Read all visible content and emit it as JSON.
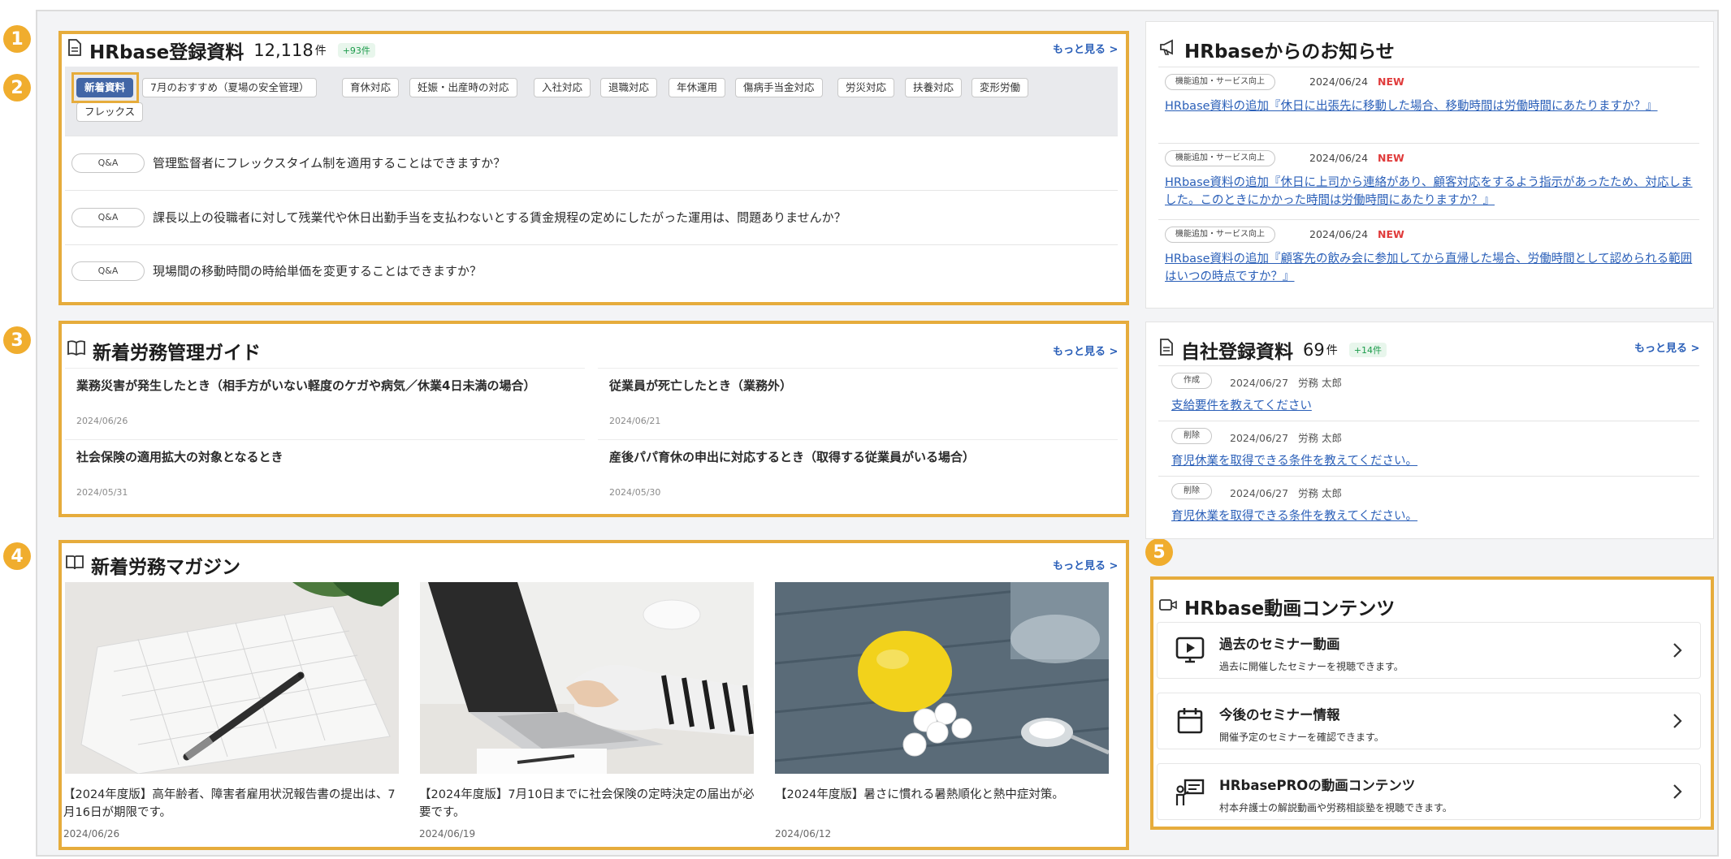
{
  "markers": [
    "1",
    "2",
    "3",
    "4",
    "5"
  ],
  "accent_color": "#e6ac3c",
  "link_color": "#2a5fb8",
  "common": {
    "more_label": "もっと見る >"
  },
  "docs": {
    "title": "HRbase登録資料",
    "count": "12,118",
    "unit": "件",
    "delta": "+93件",
    "icon": "document-icon",
    "filters": [
      "新着資料",
      "7月のおすすめ（夏場の安全管理）",
      "育休対応",
      "妊娠・出産時の対応",
      "入社対応",
      "退職対応",
      "年休運用",
      "傷病手当金対応",
      "労災対応",
      "扶養対応",
      "変形労働",
      "フレックス"
    ],
    "active_filter": "新着資料",
    "items": [
      {
        "badge": "Q&A",
        "text": "管理監督者にフレックスタイム制を適用することはできますか？"
      },
      {
        "badge": "Q&A",
        "text": "課長以上の役職者に対して残業代や休日出勤手当を支払わないとする賃金規程の定めにしたがった運用は、問題ありませんか？"
      },
      {
        "badge": "Q&A",
        "text": "現場間の移動時間の時給単価を変更することはできますか？"
      }
    ]
  },
  "guide": {
    "title": "新着労務管理ガイド",
    "icon": "book-icon",
    "items": [
      {
        "title": "業務災害が発生したとき（相手方がいない軽度のケガや病気／休業4日未満の場合）",
        "date": "2024/06/26"
      },
      {
        "title": "従業員が死亡したとき（業務外）",
        "date": "2024/06/21"
      },
      {
        "title": "社会保険の適用拡大の対象となるとき",
        "date": "2024/05/31"
      },
      {
        "title": "産後パパ育休の申出に対応するとき（取得する従業員がいる場合）",
        "date": "2024/05/30"
      }
    ]
  },
  "magazine": {
    "title": "新着労務マガジン",
    "icon": "book-open-icon",
    "items": [
      {
        "title": "【2024年度版】高年齢者、障害者雇用状況報告書の提出は、7月16日が期限です。",
        "date": "2024/06/26",
        "image": "calendar-pen-photo"
      },
      {
        "title": "【2024年度版】7月10日までに社会保険の定時決定の届出が必要です。",
        "date": "2024/06/19",
        "image": "laptop-typing-photo"
      },
      {
        "title": "【2024年度版】暑さに慣れる暑熱順化と熱中症対策。",
        "date": "2024/06/12",
        "image": "lemon-salt-photo"
      }
    ]
  },
  "notices": {
    "title": "HRbaseからのお知らせ",
    "icon": "megaphone-icon",
    "items": [
      {
        "tag": "機能追加・サービス向上",
        "date": "2024/06/24",
        "new": "NEW",
        "text": "HRbase資料の追加『休日に出張先に移動した場合、移動時間は労働時間にあたりますか？』"
      },
      {
        "tag": "機能追加・サービス向上",
        "date": "2024/06/24",
        "new": "NEW",
        "text": "HRbase資料の追加『休日に上司から連絡があり、顧客対応をするよう指示があったため、対応しました。このときにかかった時間は労働時間にあたりますか？』"
      },
      {
        "tag": "機能追加・サービス向上",
        "date": "2024/06/24",
        "new": "NEW",
        "text": "HRbase資料の追加『顧客先の飲み会に参加してから直帰した場合、労働時間として認められる範囲はいつの時点ですか？』"
      }
    ]
  },
  "company_docs": {
    "title": "自社登録資料",
    "count": "69",
    "unit": "件",
    "delta": "+14件",
    "icon": "document-icon",
    "items": [
      {
        "action": "作成",
        "date": "2024/06/27",
        "user": "労務 太郎",
        "text": "支給要件を教えてください"
      },
      {
        "action": "削除",
        "date": "2024/06/27",
        "user": "労務 太郎",
        "text": "育児休業を取得できる条件を教えてください。"
      },
      {
        "action": "削除",
        "date": "2024/06/27",
        "user": "労務 太郎",
        "text": "育児休業を取得できる条件を教えてください。"
      }
    ]
  },
  "video": {
    "title": "HRbase動画コンテンツ",
    "icon": "video-camera-icon",
    "items": [
      {
        "title": "過去のセミナー動画",
        "subtitle": "過去に開催したセミナーを視聴できます。",
        "icon": "play-screen-icon"
      },
      {
        "title": "今後のセミナー情報",
        "subtitle": "開催予定のセミナーを確認できます。",
        "icon": "calendar-icon"
      },
      {
        "title": "HRbasePROの動画コンテンツ",
        "subtitle": "村本弁護士の解説動画や労務相談塾を視聴できます。",
        "icon": "presentation-icon"
      }
    ]
  }
}
